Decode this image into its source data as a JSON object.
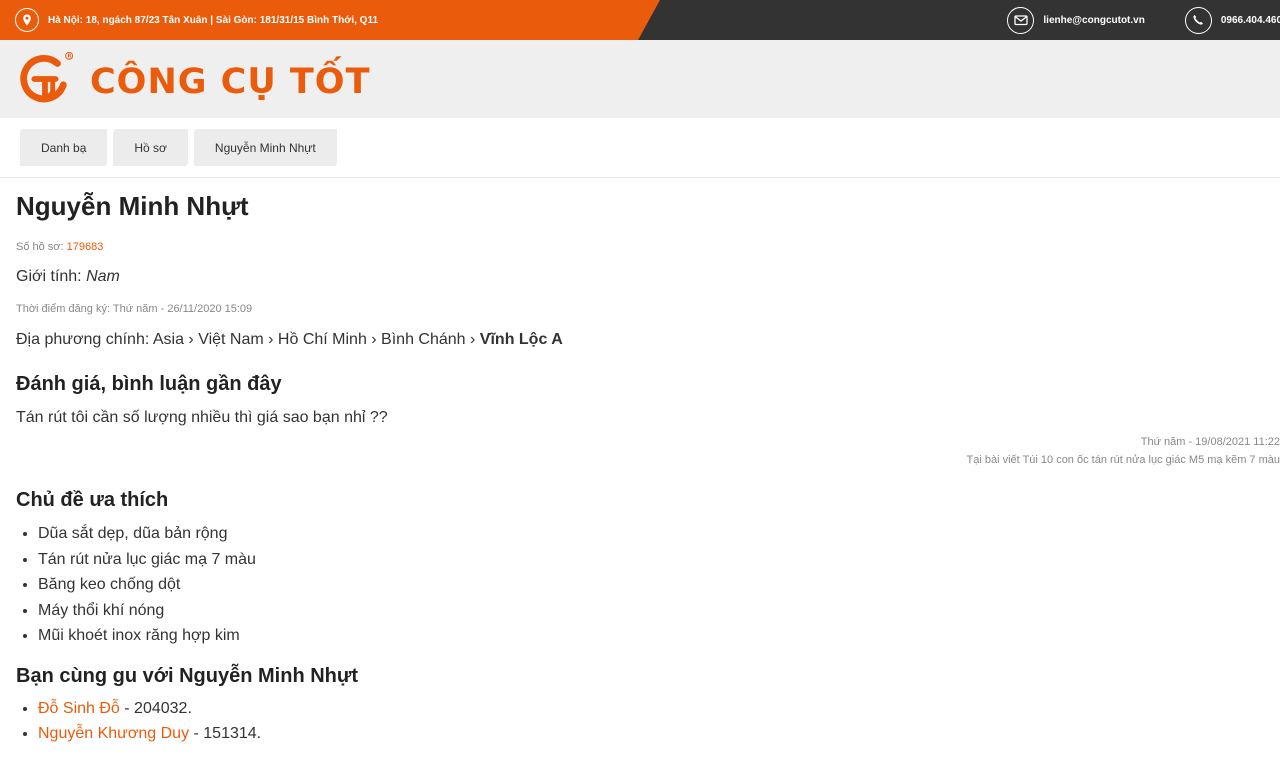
{
  "topbar": {
    "address": "Hà Nội: 18, ngách 87/23 Tân Xuân | Sài Gòn: 181/31/15 Bình Thới, Q11",
    "email": "lienhe@congcutot.vn",
    "phone": "0966.404.460"
  },
  "brand": {
    "logo_text": "CÔNG CỤ TỐT",
    "accent": "#eb5b0c"
  },
  "breadcrumb": [
    "Danh bạ",
    "Hồ sơ",
    "Nguyễn Minh Nhựt"
  ],
  "profile": {
    "name": "Nguyễn Minh Nhựt",
    "id_label": "Số hồ sơ:",
    "id_value": "179683",
    "gender_label": "Giới tính:",
    "gender_value": "Nam",
    "registered": "Thời điểm đăng ký: Thứ năm - 26/11/2020 15:09",
    "location_label": "Địa phương chính:",
    "location_path": "Asia › Việt Nam › Hồ Chí Minh › Bình Chánh ›",
    "location_last": "Vĩnh Lộc A"
  },
  "reviews": {
    "heading": "Đánh giá, bình luận gần đây",
    "comment": "Tán rút tôi cần số lượng nhiều thì giá sao bạn nhỉ ??",
    "time": "Thứ năm - 19/08/2021 11:22",
    "source": "Tại bài viết Túi 10 con ốc tán rút nửa lục giác M5 mạ kẽm 7 màu"
  },
  "topics": {
    "heading": "Chủ đề ưa thích",
    "items": [
      "Dũa sắt dẹp, dũa bản rộng",
      "Tán rút nửa lục giác mạ 7 màu",
      "Băng keo chống dột",
      "Máy thổi khí nóng",
      "Mũi khoét inox răng hợp kim"
    ]
  },
  "similar": {
    "heading": "Bạn cùng gu với Nguyễn Minh Nhựt",
    "items": [
      {
        "name": "Đỗ Sinh Đỗ",
        "id": " - 204032."
      },
      {
        "name": "Nguyễn Khương Duy",
        "id": " - 151314."
      }
    ]
  }
}
